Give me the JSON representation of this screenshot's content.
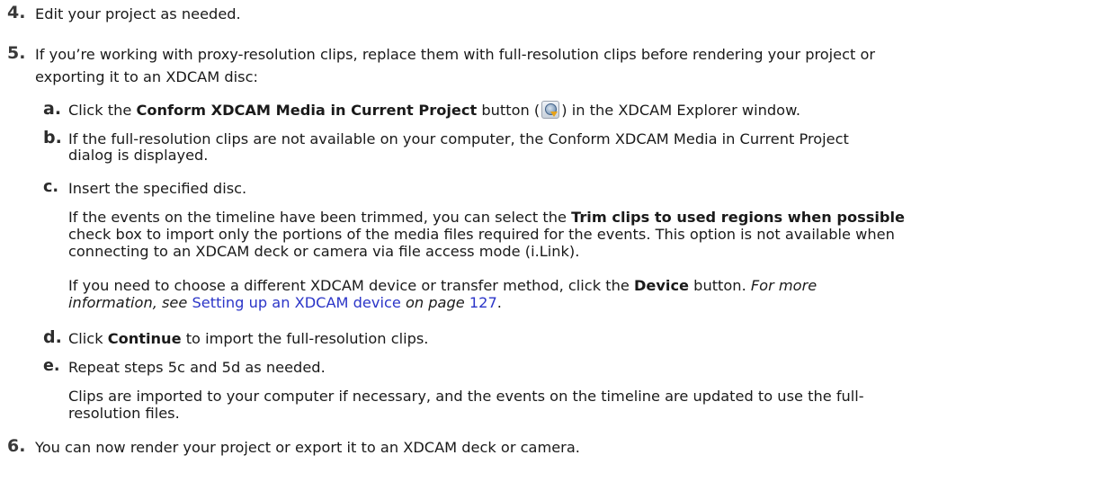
{
  "steps": [
    {
      "num": "4.",
      "text": "Edit your project as needed."
    },
    {
      "num": "5.",
      "text_line1": "If you’re working with proxy-resolution clips, replace them with full-resolution clips before rendering your project or",
      "text_line2": "exporting it to an XDCAM disc:"
    },
    {
      "num": "6.",
      "text": "You can now render your project or export it to an XDCAM deck or camera."
    }
  ],
  "substeps": {
    "a": {
      "label": "a.",
      "pre": "Click the ",
      "bold": "Conform XDCAM Media in Current Project",
      "mid": " button (",
      "post": ") in the XDCAM Explorer window.",
      "icon": "conform-xdcam-icon"
    },
    "b": {
      "label": "b.",
      "line1": "If the full-resolution clips are not available on your computer, the Conform XDCAM Media in Current Project",
      "line2": "dialog is displayed."
    },
    "c": {
      "label": "c.",
      "text": "Insert the specified disc.",
      "p1_pre": "If the events on the timeline have been trimmed, you can select the ",
      "p1_bold": "Trim clips to used regions when possible",
      "p1_line2": "check box to import only the portions of the media files required for the events. This option is not available when",
      "p1_line3": "connecting to an XDCAM deck or camera via file access mode (i.Link).",
      "p2_pre": "If you need to choose a different XDCAM device or transfer method, click the ",
      "p2_bold": "Device",
      "p2_post": " button. ",
      "p2_italic1": "For more",
      "p2_italic2_pre": "information, see ",
      "p2_link": "Setting up an XDCAM device",
      "p2_italic2_mid": " on page ",
      "p2_page": "127",
      "p2_end": "."
    },
    "d": {
      "label": "d.",
      "pre": "Click ",
      "bold": "Continue",
      "post": " to import the full-resolution clips."
    },
    "e": {
      "label": "e.",
      "text": "Repeat steps 5c and 5d as needed.",
      "p_line1": "Clips are imported to your computer if necessary, and the events on the timeline are updated to use the full-",
      "p_line2": "resolution files."
    }
  }
}
